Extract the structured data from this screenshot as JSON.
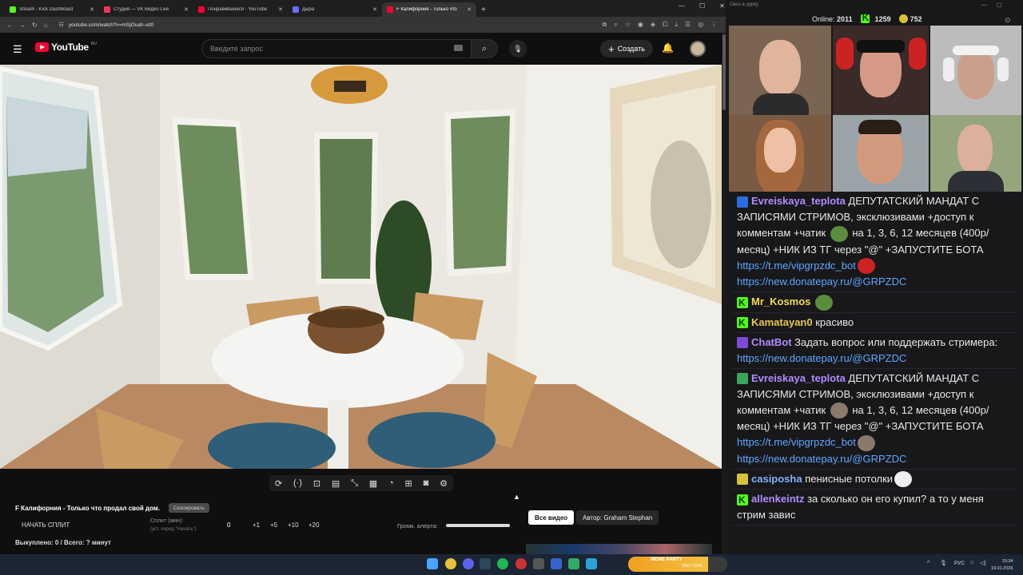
{
  "browser": {
    "tabs": [
      {
        "title": "Stream - Kick Dashboard",
        "color": "#53fc18",
        "active": false
      },
      {
        "title": "Студия — VK Видео Live",
        "color": "#ff3355",
        "active": false
      },
      {
        "title": "Понравившиеся - YouTube",
        "color": "#ff0033",
        "active": false
      },
      {
        "title": "Дыра",
        "color": "#6b6bff",
        "active": false
      },
      {
        "title": "F Калифорния - Только что",
        "color": "#ff0033",
        "active": true
      }
    ],
    "url": "youtube.com/watch?v=mSjOuah-xd0"
  },
  "youtube": {
    "logo_text": "YouTube",
    "country_code": "RU",
    "search_placeholder": "Введите запрос",
    "create_label": "Создать"
  },
  "controls": {
    "video_title": "F Калифорния - Только что продал свой дом.",
    "copy_label": "Скопировать",
    "start_split": "НАЧАТЬ СПЛИТ",
    "split_label": "Сплит (мин):",
    "split_hint": "(уст. перед \"Начать\")",
    "split_value": "0",
    "increments": [
      "+1",
      "+5",
      "+10",
      "+20"
    ],
    "alert_volume_label": "Громк. алерта:",
    "alert_volume": 1.0,
    "all_videos": "Все видео",
    "author": "Автор: Graham Stephan",
    "status": "Выкуплено: 0 / Всего: ? минут"
  },
  "stream_panel": {
    "window_title": "Окно в дурку",
    "online_label": "Online:",
    "online_value": "2011",
    "kick_count": "1259",
    "other_count": "752"
  },
  "chat": [
    {
      "icon": "sword",
      "user": "Evreiskaya_teplota",
      "color": "#b18cff",
      "parts": [
        {
          "t": "ДЕПУТАТСКИЙ МАНДАТ С ЗАПИСЯМИ СТРИМОВ, эксклюзивами +доступ к комментам +чатик "
        },
        {
          "e": "#5a8d3c"
        },
        {
          "t": " на 1, 3, 6, 12 месяцев (400р/месяц) +НИК ИЗ ТГ через \"@\" +ЗАПУСТИТЕ БОТА "
        },
        {
          "l": "https://t.me/vipgrpzdc_bot"
        },
        {
          "e": "#c22"
        },
        {
          "t": " "
        },
        {
          "l": "https://new.donatepay.ru/@GRPZDC"
        }
      ]
    },
    {
      "icon": "kick",
      "user": "Mr_Kosmos",
      "color": "#f5d94a",
      "parts": [
        {
          "e": "#5a8d3c"
        }
      ]
    },
    {
      "icon": "kick",
      "user": "Kamatayan0",
      "color": "#e9c84a",
      "parts": [
        {
          "t": "красиво"
        }
      ]
    },
    {
      "icon": "bot",
      "user": "ChatBot",
      "color": "#b18cff",
      "parts": [
        {
          "t": "Задать вопрос или поддержать стримера: "
        },
        {
          "l": "https://new.donatepay.ru/@GRPZDC"
        }
      ]
    },
    {
      "icon": "pen",
      "user": "Evreiskaya_teplota",
      "color": "#b18cff",
      "parts": [
        {
          "t": "ДЕПУТАТСКИЙ МАНДАТ С ЗАПИСЯМИ СТРИМОВ, эксклюзивами +доступ к комментам +чатик "
        },
        {
          "e": "#8a7a6a"
        },
        {
          "t": " на 1, 3, 6, 12 месяцев (400р/месяц) +НИК ИЗ ТГ через \"@\" +ЗАПУСТИТЕ БОТА "
        },
        {
          "l": "https://t.me/vipgrpzdc_bot"
        },
        {
          "e": "#8a7a6a"
        },
        {
          "t": " "
        },
        {
          "l": "https://new.donatepay.ru/@GRPZDC"
        }
      ]
    },
    {
      "icon": "pepe",
      "user": "casiposha",
      "color": "#7fb2ff",
      "parts": [
        {
          "t": "пенисные потолки"
        },
        {
          "e": "#eee"
        }
      ]
    },
    {
      "icon": "kick",
      "user": "allenkeintz",
      "color": "#b18cff",
      "parts": [
        {
          "t": "за сколько он его купил? а то у меня стрим завис"
        }
      ]
    }
  ],
  "taskbar": {
    "lang": "РУС",
    "time": "15:34",
    "date": "19.01.2026",
    "widget_label": "MEME PARTY",
    "widget_counter": "1250 / 1500"
  }
}
